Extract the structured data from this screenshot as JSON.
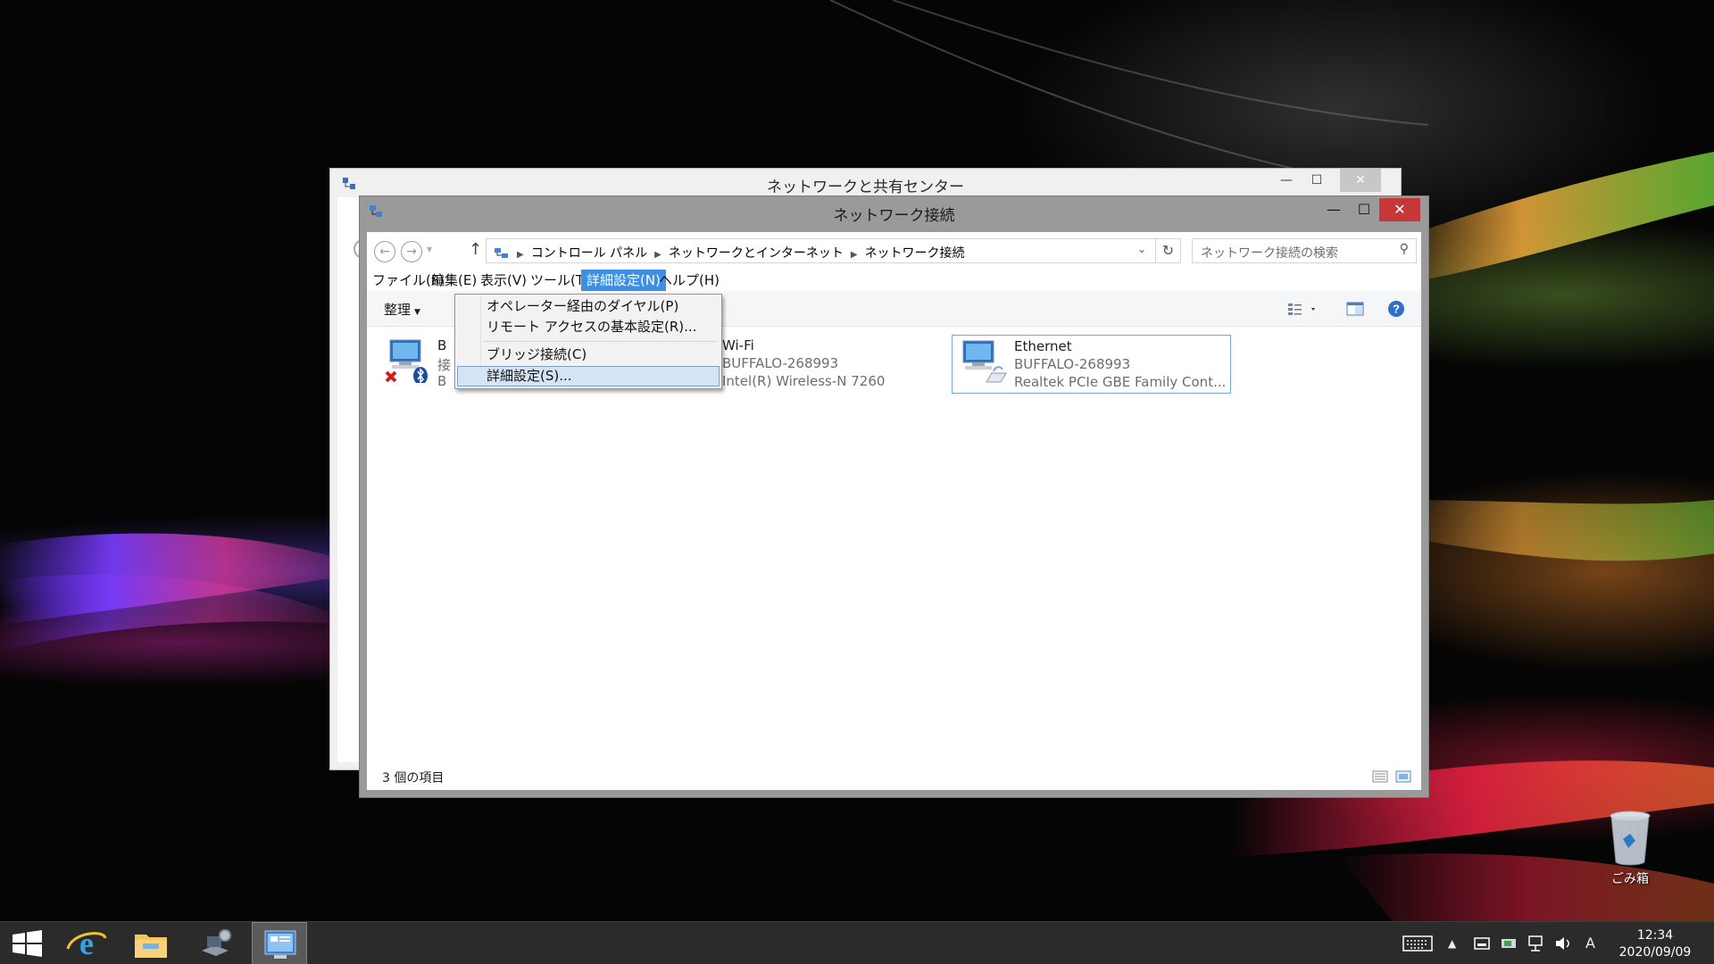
{
  "back_window": {
    "title": "ネットワークと共有センター",
    "controls": {
      "minimize": "—",
      "maximize": "☐",
      "close": "✕"
    }
  },
  "front_window": {
    "title": "ネットワーク接続",
    "controls": {
      "minimize": "—",
      "maximize": "☐",
      "close": "✕"
    }
  },
  "address_bar": {
    "breadcrumbs": [
      "コントロール パネル",
      "ネットワークとインターネット",
      "ネットワーク接続"
    ],
    "search_placeholder": "ネットワーク接続の検索"
  },
  "menubar": {
    "items": [
      "ファイル(F)",
      "編集(E)",
      "表示(V)",
      "ツール(T)",
      "詳細設定(N)",
      "ヘルプ(H)"
    ],
    "active_index": 4
  },
  "toolbar": {
    "organize_label": "整理",
    "icons": [
      "change-view-icon",
      "preview-pane-icon",
      "help-icon"
    ]
  },
  "dropdown_menu": {
    "items": [
      "オペレーター経由のダイヤル(P)",
      "リモート アクセスの基本設定(R)...",
      "ブリッジ接続(C)",
      "詳細設定(S)..."
    ],
    "highlighted_index": 3
  },
  "connections": [
    {
      "name": "B",
      "line2": "接",
      "line3": "B",
      "icon": "bluetooth-network-icon",
      "status": "disabled"
    },
    {
      "name": "Wi-Fi",
      "line2": "BUFFALO-268993",
      "line3": "Intel(R) Wireless-N 7260",
      "icon": "wifi-network-icon"
    },
    {
      "name": "Ethernet",
      "line2": "BUFFALO-268993",
      "line3": "Realtek PCIe GBE Family Cont...",
      "icon": "ethernet-network-icon",
      "selected": true
    }
  ],
  "status_bar": {
    "item_count": "3 個の項目"
  },
  "desktop": {
    "recycle_bin_label": "ごみ箱"
  },
  "taskbar": {
    "apps": [
      "windows-start-icon",
      "internet-explorer-icon",
      "file-explorer-icon",
      "network-settings-icon",
      "control-panel-icon"
    ],
    "ime_indicator": "A",
    "time": "12:34",
    "date": "2020/09/09"
  },
  "colors": {
    "accent_menu": "#3e8ee6",
    "close_button": "#c6373a",
    "selection_border": "#72a7dd",
    "taskbar": "#2b2b2b"
  }
}
